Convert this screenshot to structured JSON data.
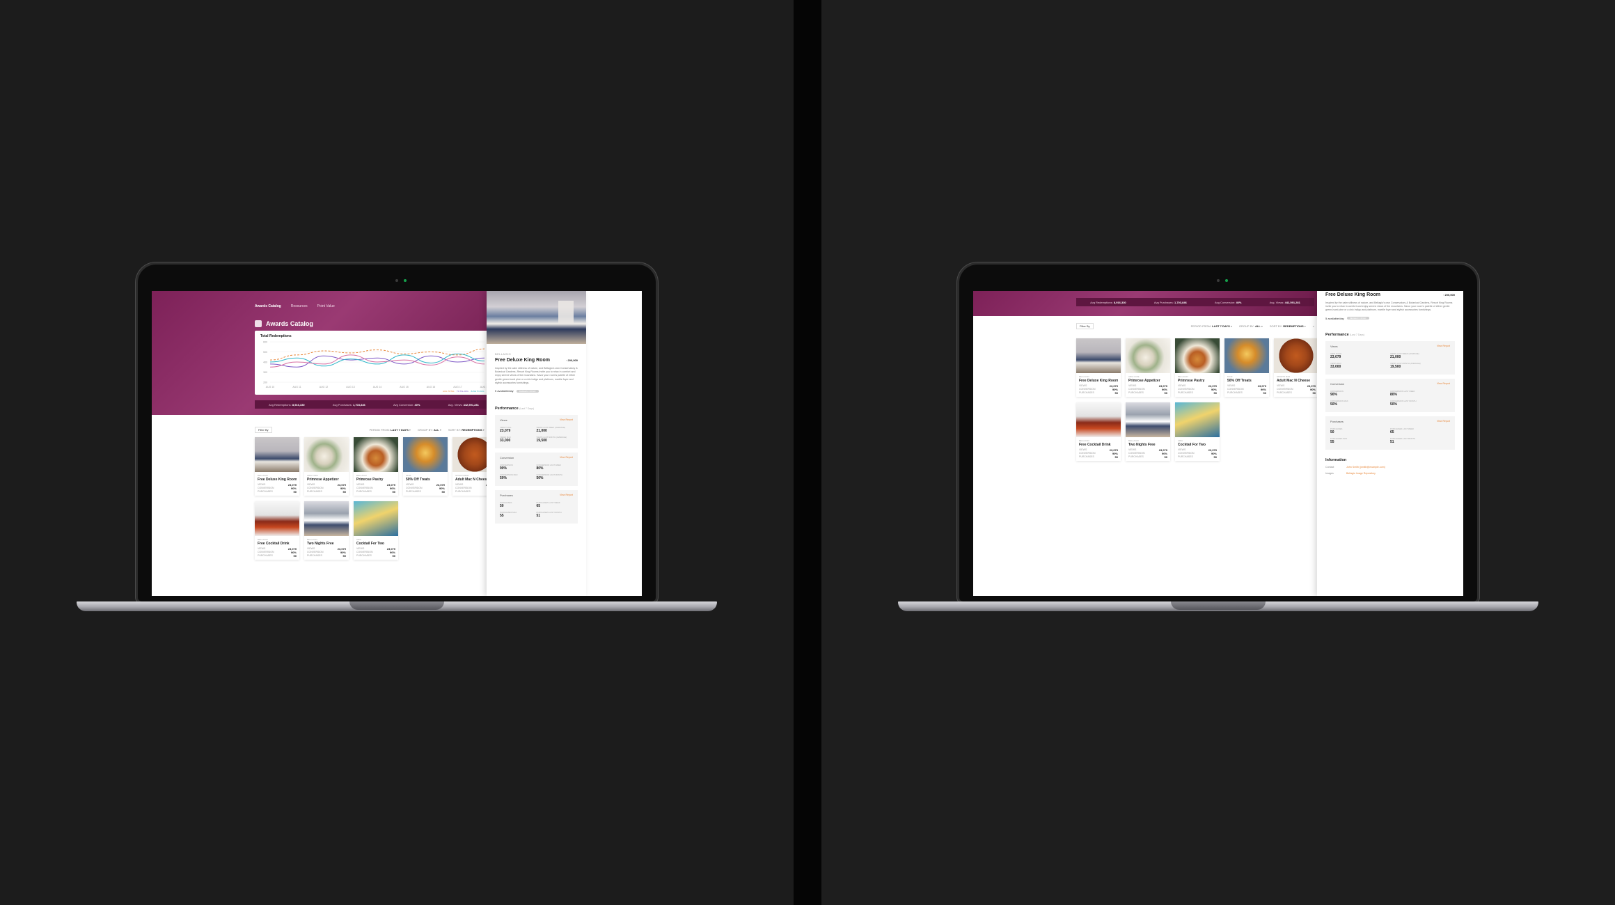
{
  "nav": {
    "items": [
      "Awards Catalog",
      "Resources",
      "Point Value"
    ]
  },
  "page": {
    "title": "Awards Catalog"
  },
  "chart_data": {
    "type": "line",
    "title": "Total Redemptions",
    "x": [
      "AUG 10",
      "AUG 11",
      "AUG 12",
      "AUG 13",
      "AUG 14",
      "AUG 15",
      "AUG 16",
      "AUG 17",
      "AUG 18"
    ],
    "series": [
      {
        "name": "AUG TOTAL",
        "values": [
          420,
          470,
          510,
          490,
          520,
          480,
          500,
          470,
          530
        ]
      },
      {
        "name": "TO TAL AVG",
        "values": [
          380,
          350,
          460,
          420,
          440,
          380,
          460,
          400,
          440
        ]
      },
      {
        "name": "JUNE TO AVG",
        "values": [
          400,
          440,
          360,
          430,
          380,
          470,
          390,
          480,
          410
        ]
      },
      {
        "name": "",
        "values": [
          350,
          400,
          380,
          470,
          400,
          420,
          370,
          450,
          380
        ]
      }
    ],
    "ylim": [
      200,
      600
    ],
    "ticks": [
      "600",
      "500",
      "400",
      "300",
      "200"
    ]
  },
  "kpis": [
    {
      "label": "Avg Redemptions",
      "value": "8,916,330"
    },
    {
      "label": "Avg Purchases",
      "value": "1,703,846"
    },
    {
      "label": "Avg Conversion",
      "value": "40%"
    },
    {
      "label": "Avg. Views",
      "value": "442,591,281"
    }
  ],
  "filter": {
    "label": "Filter By",
    "period_label": "PERIOD FROM:",
    "period": "LAST 7 DAYS",
    "group_label": "GROUP BY:",
    "group": "ALL",
    "sort_label": "SORT BY:",
    "sort": "REDEMPTIONS"
  },
  "cards": [
    {
      "prop": "BELLAGIO",
      "name": "Free Deluxe King Room",
      "views": "23,079",
      "conv": "90%",
      "purch": "50",
      "img": "room"
    },
    {
      "prop": "ARIA CAFE",
      "name": "Primrose Appetizer",
      "views": "23,079",
      "conv": "90%",
      "purch": "50",
      "img": "salad"
    },
    {
      "prop": "BELLAGIO",
      "name": "Primrose Pastry",
      "views": "23,079",
      "conv": "90%",
      "purch": "50",
      "img": "pastry"
    },
    {
      "prop": "MGM",
      "name": "50% Off Treats",
      "views": "23,079",
      "conv": "90%",
      "purch": "50",
      "img": "donut"
    },
    {
      "prop": "SPORTS BAR",
      "name": "Adult Mac N Cheese",
      "views": "23,079",
      "conv": "90%",
      "purch": "50",
      "img": "mac"
    },
    {
      "prop": "BELLAGIO",
      "name": "Free Cocktail Drink",
      "views": "23,079",
      "conv": "90%",
      "purch": "50",
      "img": "drink"
    },
    {
      "prop": "BELLAGIO",
      "name": "Two Nights Free",
      "views": "23,079",
      "conv": "90%",
      "purch": "50",
      "img": "suite"
    },
    {
      "prop": "ARIA",
      "name": "Cocktail For Two",
      "views": "23,079",
      "conv": "90%",
      "purch": "50",
      "img": "cocktail"
    }
  ],
  "card_labels": {
    "views": "VIEWS",
    "conv": "CONVERSION",
    "purch": "PURCHASES"
  },
  "detail": {
    "property": "BELLAGIO",
    "title": "Free Deluxe King Room",
    "points": "200,000",
    "desc": "Inspired by the calm stillness of nature, and Bellagio's own Conservatory & Botanical Gardens, Resort King Rooms invite you to relax in comfort and enjoy serene views of the mountains. Savor your room's palette of either gentle green-hued pine or a chic indigo and platinum, marble foyer and stylish accessories furnishings.",
    "available": "5 available/day",
    "tag": "REDEEM OFFER",
    "perf_title": "Performance",
    "perf_sub": "(Last 7 Days)",
    "view_report": "View Report",
    "metrics": [
      {
        "name": "Views",
        "a_label": "VIEW TOTAL",
        "a": "23,079",
        "b_label": "VIEWS LAST WEEK (AVERAGE)",
        "b": "21,000",
        "c_label": "VIEWS MAX",
        "c": "33,000",
        "d_label": "VIEWS LAST MONTH (AVERAGE)",
        "d": "19,500"
      },
      {
        "name": "Conversion",
        "a_label": "CONVERSION",
        "a": "90%",
        "b_label": "CONVERSION LAST WEEK",
        "b": "80%",
        "c_label": "CONVERSION MAX",
        "c": "50%",
        "d_label": "CONVERSION LAST MONTH",
        "d": "50%"
      },
      {
        "name": "Purchases",
        "a_label": "PURCHASES",
        "a": "50",
        "b_label": "PURCHASES LAST WEEK",
        "b": "65",
        "c_label": "PURCHASES MAX",
        "c": "55",
        "d_label": "PURCHASES LAST MONTH",
        "d": "51"
      }
    ],
    "info_title": "Information",
    "contact_label": "Contact",
    "contact": "John Smith (jsmith@example.com)",
    "images_label": "Images",
    "images": "Bellagio Image Repository"
  }
}
